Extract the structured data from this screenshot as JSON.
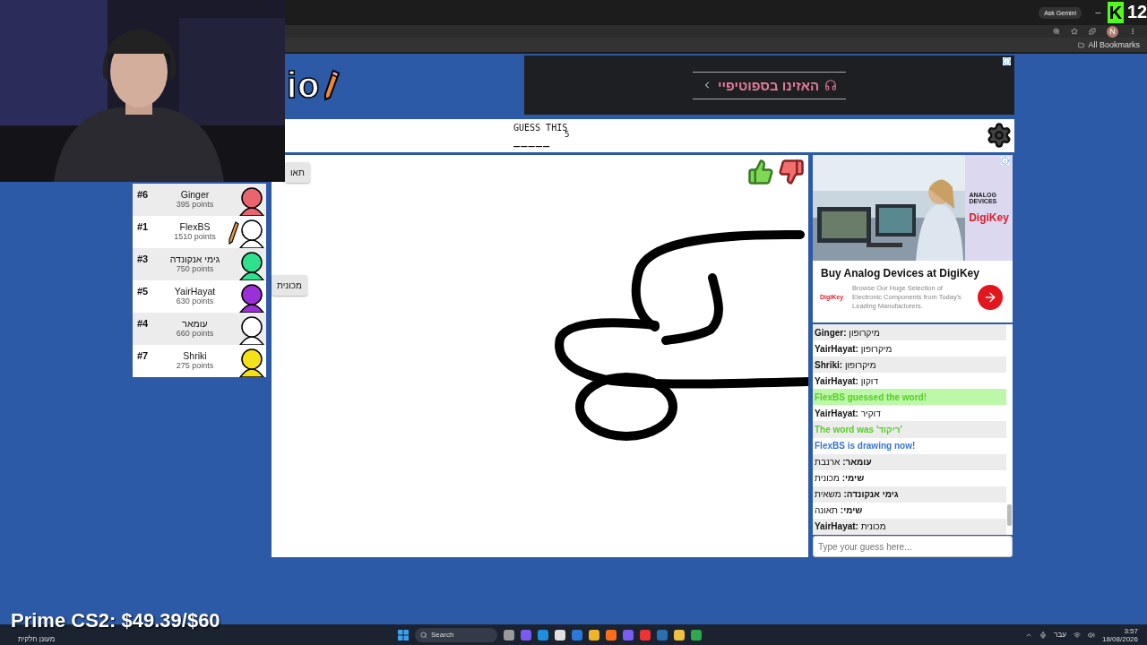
{
  "overlay": {
    "goal": "Prime CS2: $49.39/$60",
    "badge": "K",
    "counter": "12"
  },
  "browser": {
    "ask": "Ask Gemini",
    "profile": "N",
    "bookmarks": "All Bookmarks"
  },
  "game": {
    "logo": "io",
    "ad_banner": "האזינו בספוטיפיי",
    "header": {
      "label": "GUESS THIS",
      "count": "5",
      "hint": "_____"
    },
    "top_bubble": "תאו",
    "players": [
      {
        "rank": "#6",
        "name": "Ginger",
        "points": "395 points",
        "color": "#e8646e",
        "drawing": false
      },
      {
        "rank": "#1",
        "name": "FlexBS",
        "points": "1510 points",
        "color": "#ffffff",
        "drawing": true
      },
      {
        "rank": "#3",
        "name": "גימי אנקונדה",
        "points": "750 points",
        "color": "#2fe08e",
        "drawing": false
      },
      {
        "rank": "#5",
        "name": "YairHayat",
        "points": "630 points",
        "color": "#9b30d9",
        "drawing": false,
        "bubble": "מכונית"
      },
      {
        "rank": "#4",
        "name": "עומאר",
        "points": "660 points",
        "color": "#ffffff",
        "drawing": false
      },
      {
        "rank": "#7",
        "name": "Shriki",
        "points": "275 points",
        "color": "#f5e11a",
        "drawing": false
      }
    ],
    "side_ad": {
      "brand": "ANALOG DEVICES",
      "brand2": "DigiKey",
      "title": "Buy Analog Devices at DigiKey",
      "small_brand": "DigiKey",
      "body": "Browse Our Huge Selection of Electronic Components from Today's Leading Manufacturers."
    },
    "chat": {
      "messages": [
        {
          "kind": "guess",
          "name": "Ginger:",
          "text": "מיקרופון"
        },
        {
          "kind": "guess",
          "name": "YairHayat:",
          "text": "מיקרופון"
        },
        {
          "kind": "guess",
          "name": "Shriki:",
          "text": "מיקרופון"
        },
        {
          "kind": "guess",
          "name": "YairHayat:",
          "text": "דוקון"
        },
        {
          "kind": "success",
          "text": "FlexBS guessed the word!"
        },
        {
          "kind": "guess",
          "name": "YairHayat:",
          "text": "דוקיר"
        },
        {
          "kind": "reveal",
          "text": "The word was 'ריקוד'"
        },
        {
          "kind": "drawing",
          "text": "FlexBS is drawing now!"
        },
        {
          "kind": "guess",
          "name": "עומאר:",
          "text": "ארנבת"
        },
        {
          "kind": "guess",
          "name": "שימי:",
          "text": "מכונית"
        },
        {
          "kind": "guess",
          "name": "גימי אנקונדה:",
          "text": "משאית"
        },
        {
          "kind": "guess",
          "name": "שימי:",
          "text": "תאונה"
        },
        {
          "kind": "guess",
          "name": "YairHayat:",
          "text": "מכונית"
        }
      ],
      "placeholder": "Type your guess here..."
    }
  },
  "taskbar": {
    "weather": "מעונן חלקית",
    "search": "Search",
    "language": "עבר",
    "time": "3:57",
    "date": "18/08/2026"
  }
}
